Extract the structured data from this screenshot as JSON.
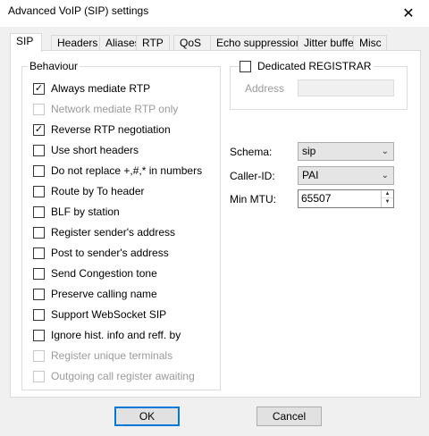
{
  "window": {
    "title": "Advanced VoIP (SIP) settings",
    "close_glyph": "✕"
  },
  "tabs": [
    {
      "label": "SIP",
      "active": true
    },
    {
      "label": "Headers",
      "active": false
    },
    {
      "label": "Aliases",
      "active": false
    },
    {
      "label": "RTP",
      "active": false
    },
    {
      "label": "QoS",
      "active": false
    },
    {
      "label": "Echo suppression",
      "active": false
    },
    {
      "label": "Jitter buffer",
      "active": false
    },
    {
      "label": "Misc",
      "active": false
    }
  ],
  "behaviour": {
    "title": "Behaviour",
    "options": [
      {
        "label": "Always mediate RTP",
        "checked": true,
        "enabled": true
      },
      {
        "label": "Network mediate RTP only",
        "checked": false,
        "enabled": false
      },
      {
        "label": "Reverse RTP negotiation",
        "checked": true,
        "enabled": true
      },
      {
        "label": "Use short headers",
        "checked": false,
        "enabled": true
      },
      {
        "label": "Do not replace +,#,* in numbers",
        "checked": false,
        "enabled": true
      },
      {
        "label": "Route by To header",
        "checked": false,
        "enabled": true
      },
      {
        "label": "BLF by station",
        "checked": false,
        "enabled": true
      },
      {
        "label": "Register sender's address",
        "checked": false,
        "enabled": true
      },
      {
        "label": "Post to sender's address",
        "checked": false,
        "enabled": true
      },
      {
        "label": "Send Congestion tone",
        "checked": false,
        "enabled": true
      },
      {
        "label": "Preserve calling name",
        "checked": false,
        "enabled": true
      },
      {
        "label": "Support WebSocket SIP",
        "checked": false,
        "enabled": true
      },
      {
        "label": "Ignore hist. info and reff. by",
        "checked": false,
        "enabled": true
      },
      {
        "label": "Register unique terminals",
        "checked": false,
        "enabled": false
      },
      {
        "label": "Outgoing call register awaiting",
        "checked": false,
        "enabled": false
      }
    ]
  },
  "registrar": {
    "label": "Dedicated REGISTRAR",
    "checked": false,
    "address_label": "Address",
    "address_value": ""
  },
  "fields": {
    "schema_label": "Schema:",
    "schema_value": "sip",
    "caller_id_label": "Caller-ID:",
    "caller_id_value": "PAI",
    "min_mtu_label": "Min MTU:",
    "min_mtu_value": "65507"
  },
  "buttons": {
    "ok": "OK",
    "cancel": "Cancel"
  },
  "icons": {
    "check": "✓",
    "chevron": "⌄",
    "spin_up": "▲",
    "spin_down": "▼"
  }
}
